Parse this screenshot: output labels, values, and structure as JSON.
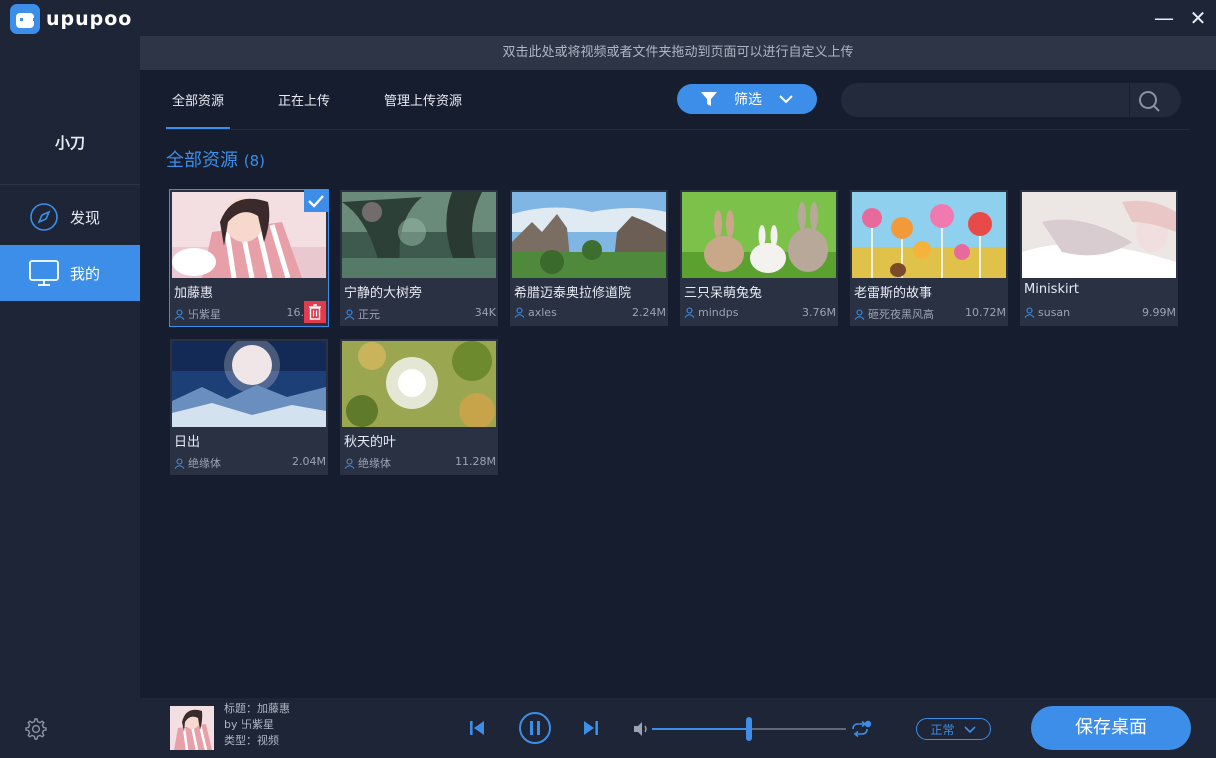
{
  "app": {
    "name": "upupoo",
    "minimize_label": "—",
    "close_label": "✕"
  },
  "sidebar": {
    "user_name": "小刀",
    "items": [
      {
        "label": "发现",
        "icon": "compass-icon"
      },
      {
        "label": "我的",
        "icon": "monitor-icon"
      }
    ]
  },
  "banner": {
    "text": "双击此处或将视频或者文件夹拖动到页面可以进行自定义上传"
  },
  "tabs": [
    {
      "label": "全部资源"
    },
    {
      "label": "正在上传"
    },
    {
      "label": "管理上传资源"
    }
  ],
  "filter": {
    "label": "筛选"
  },
  "search": {
    "placeholder": "",
    "value": ""
  },
  "section": {
    "title": "全部资源",
    "count": "(8)"
  },
  "cards": [
    {
      "title": "加藤惠",
      "author": "卐紫星",
      "size": "16."
    },
    {
      "title": "宁静的大树旁",
      "author": "正元",
      "size": "34K"
    },
    {
      "title": "希腊迈泰奥拉修道院",
      "author": "axles",
      "size": "2.24M"
    },
    {
      "title": "三只呆萌兔兔",
      "author": "mindps",
      "size": "3.76M"
    },
    {
      "title": "老雷斯的故事",
      "author": "砸死夜黑风高",
      "size": "10.72M"
    },
    {
      "title": "Miniskirt",
      "author": "susan",
      "size": "9.99M"
    },
    {
      "title": "日出",
      "author": "绝缘体",
      "size": "2.04M"
    },
    {
      "title": "秋天的叶",
      "author": "绝缘体",
      "size": "11.28M"
    }
  ],
  "player": {
    "title_line": "标题：加藤惠",
    "author_line": "by 卐紫星",
    "type_line": "类型：视频",
    "volume": 0.5,
    "mode_label": "正常",
    "save_label": "保存桌面"
  },
  "colors": {
    "accent": "#3d8ee8",
    "background": "#161d2e",
    "sidebar": "#1e2536",
    "danger": "#e23b4e"
  }
}
